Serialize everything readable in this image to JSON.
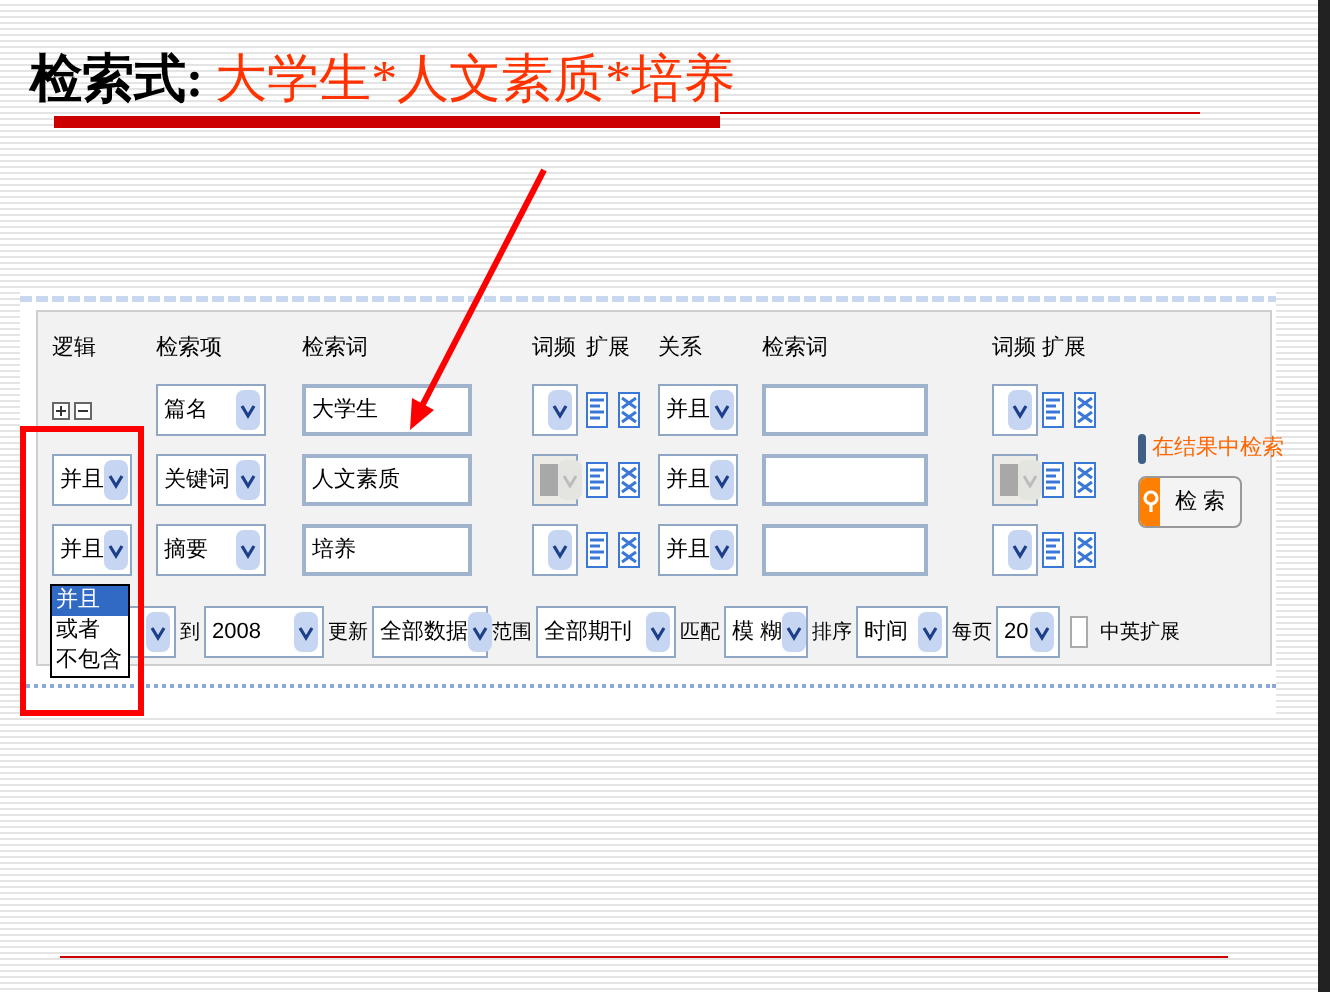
{
  "slide": {
    "label": "检索式:",
    "query": "大学生*人文素质*培养"
  },
  "search_form": {
    "headers": [
      "逻辑",
      "检索项",
      "检索词",
      "词频",
      "扩展",
      "关系",
      "检索词",
      "词频",
      "扩展"
    ],
    "rows": [
      {
        "logic": {
          "kind": "buttons"
        },
        "field": "篇名",
        "term": "大学生",
        "freq_disabled": false,
        "relation": "并且",
        "term2": "",
        "freq2_disabled": false
      },
      {
        "logic": {
          "kind": "select",
          "value": "并且"
        },
        "field": "关键词",
        "term": "人文素质",
        "freq_disabled": true,
        "relation": "并且",
        "term2": "",
        "freq2_disabled": true
      },
      {
        "logic": {
          "kind": "select",
          "value": "并且",
          "expanded": true,
          "options": [
            {
              "label": "并且",
              "selected": true
            },
            {
              "label": "或者",
              "selected": false
            },
            {
              "label": "不包含",
              "selected": false
            }
          ]
        },
        "field": "摘要",
        "term": "培养",
        "freq_disabled": false,
        "relation": "并且",
        "term2": "",
        "freq2_disabled": false
      }
    ],
    "search_in_results": {
      "label": "在结果中检索",
      "checked": false
    },
    "search_button": "检 索",
    "options_row": [
      {
        "kind": "select"
      },
      {
        "kind": "label",
        "text": "到"
      },
      {
        "kind": "select",
        "value": "2008"
      },
      {
        "kind": "label",
        "text": "更新"
      },
      {
        "kind": "select",
        "value": "全部数据"
      },
      {
        "kind": "label",
        "text": "范围"
      },
      {
        "kind": "select",
        "value": "全部期刊"
      },
      {
        "kind": "label",
        "text": "匹配"
      },
      {
        "kind": "select",
        "value": "模 糊"
      },
      {
        "kind": "label",
        "text": "排序"
      },
      {
        "kind": "select",
        "value": "时间"
      },
      {
        "kind": "label",
        "text": "每页"
      },
      {
        "kind": "select",
        "value": "20"
      },
      {
        "kind": "checkbox",
        "checked": false
      },
      {
        "kind": "label",
        "text": "中英扩展"
      }
    ]
  }
}
